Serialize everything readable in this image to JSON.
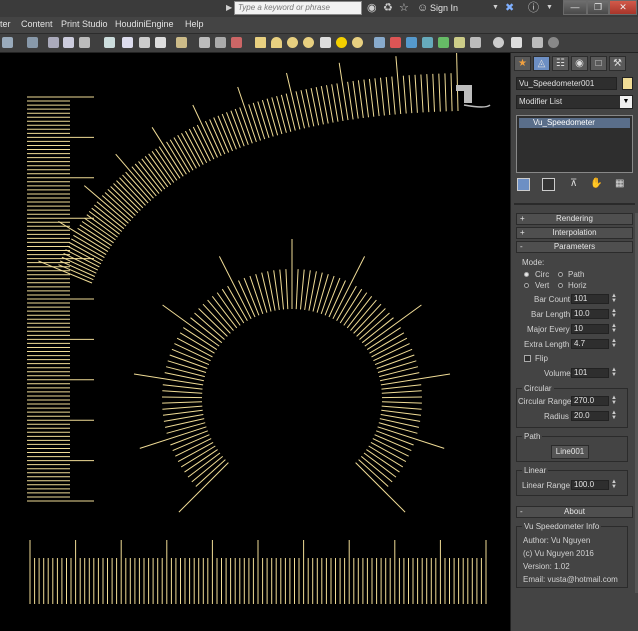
{
  "menubar": {
    "items": [
      "ter",
      "Content",
      "Print Studio",
      "HoudiniEngine",
      "Help"
    ]
  },
  "search": {
    "placeholder": "Type a keyword or phrase"
  },
  "account": {
    "signin_label": "Sign In"
  },
  "panel": {
    "object_name": "Vu_Speedometer001",
    "object_color": "#f0dc96",
    "modifier_list_label": "Modifier List",
    "stack_item": "Vu_Speedometer",
    "rollouts": {
      "rendering": "Rendering",
      "interpolation": "Interpolation",
      "parameters": "Parameters",
      "about": "About",
      "plus": "+",
      "minus": "-"
    },
    "parameters": {
      "mode_label": "Mode:",
      "mode_circ": "Circ",
      "mode_path": "Path",
      "mode_vert": "Vert",
      "mode_horiz": "Horiz",
      "bar_count_label": "Bar Count",
      "bar_count": "101",
      "bar_length_label": "Bar Length",
      "bar_length": "10.0",
      "major_every_label": "Major Every",
      "major_every": "10",
      "extra_length_label": "Extra Length",
      "extra_length": "4.7",
      "flip_label": "Flip",
      "volume_label": "Volume",
      "volume": "101",
      "circular_group": "Circular",
      "circular_range_label": "Circular Range",
      "circular_range": "270.0",
      "radius_label": "Radius",
      "radius": "20.0",
      "path_group": "Path",
      "path_button": "Line001",
      "linear_group": "Linear",
      "linear_range_label": "Linear Range",
      "linear_range": "100.0"
    },
    "about": {
      "group": "Vu Speedometer Info",
      "author": "Author: Vu Nguyen",
      "copyright": "(c) Vu Nguyen 2016",
      "version": "Version: 1.02",
      "email": "Email: vusta@hotmail.com"
    }
  },
  "scene": {
    "line_color": "#f0dc96",
    "bar_count": 101,
    "major_every": 10
  }
}
